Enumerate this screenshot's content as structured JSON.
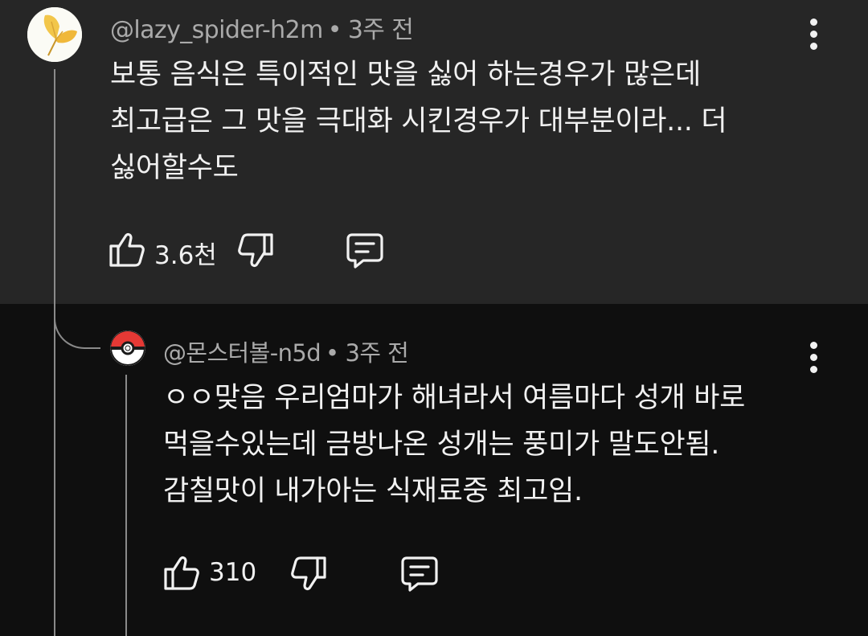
{
  "comments": [
    {
      "author": "@lazy_spider-h2m",
      "separator": "•",
      "time": "3주 전",
      "lines": [
        "보통 음식은 특이적인 맛을 싫어 하는경우가 많은데",
        "최고급은 그 맛을 극대화 시킨경우가 대부분이라... 더",
        "싫어할수도"
      ],
      "likes": "3.6천",
      "avatar_icon": "ginkgo-leaf-avatar",
      "accent": "#f2c64a"
    },
    {
      "author": "@몬스터볼-n5d",
      "separator": "•",
      "time": "3주 전",
      "lines": [
        "ㅇㅇ맞음 우리엄마가 해녀라서 여름마다 성개 바로",
        "먹을수있는데 금방나온 성개는 풍미가 말도안됨.",
        "감칠맛이 내가아는 식재료중 최고임."
      ],
      "likes": "310",
      "avatar_icon": "pokeball-avatar",
      "accent": "#e53935"
    }
  ],
  "icons": {
    "like": "thumbs-up-icon",
    "dislike": "thumbs-down-icon",
    "reply": "comment-reply-icon",
    "more": "more-vertical-icon"
  },
  "colors": {
    "top_comment_bg": "#262626",
    "reply_bg": "#0f0f0f",
    "text": "#f1f1f1",
    "meta": "#aaaaaa",
    "thread_line": "#8a8a8a"
  }
}
